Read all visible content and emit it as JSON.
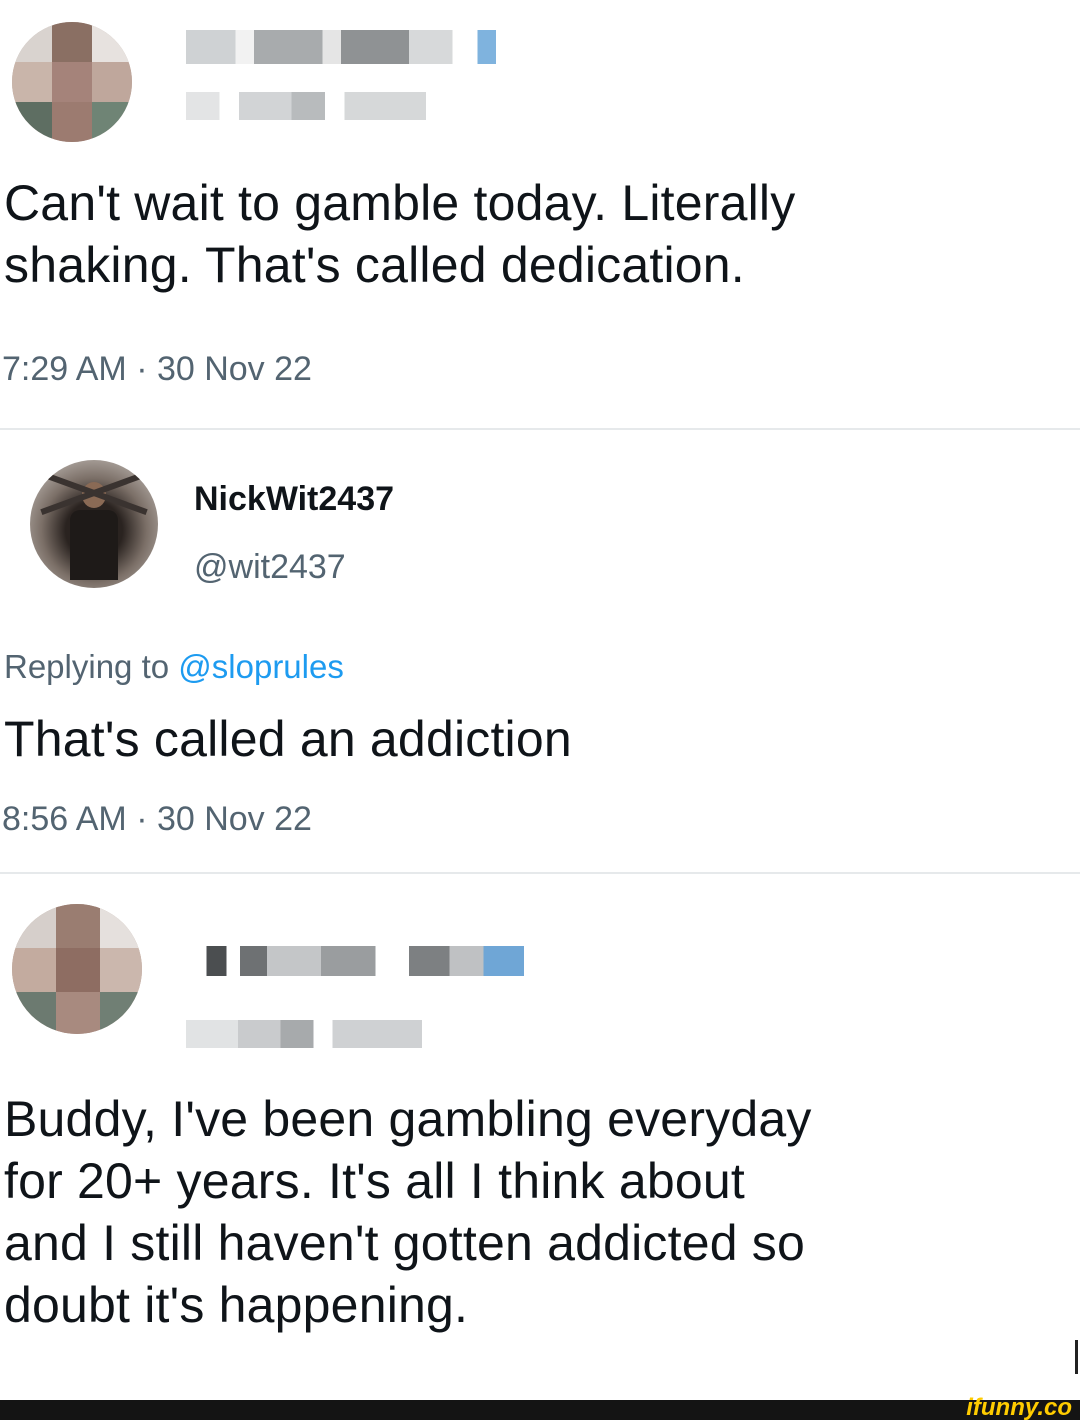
{
  "tweet1": {
    "text_lines": [
      "Can't wait to gamble today. Literally",
      "shaking. That's called dedication."
    ],
    "time": "7:29 AM · 30 Nov 22"
  },
  "tweet2": {
    "display_name": "NickWit2437",
    "handle": "@wit2437",
    "replying_prefix": "Replying to",
    "replying_handle": "@sloprules",
    "text": "That's called an addiction",
    "time": "8:56 AM · 30 Nov 22"
  },
  "tweet3": {
    "text_lines": [
      "Buddy, I've been gambling everyday",
      "for 20+ years. It's all I think about",
      "and I still haven't gotten addicted so",
      "doubt it's happening."
    ]
  },
  "watermark": "ifunny.co",
  "colors": {
    "accent": "#1d9bf0",
    "muted": "#536471",
    "text": "#0f1419"
  }
}
